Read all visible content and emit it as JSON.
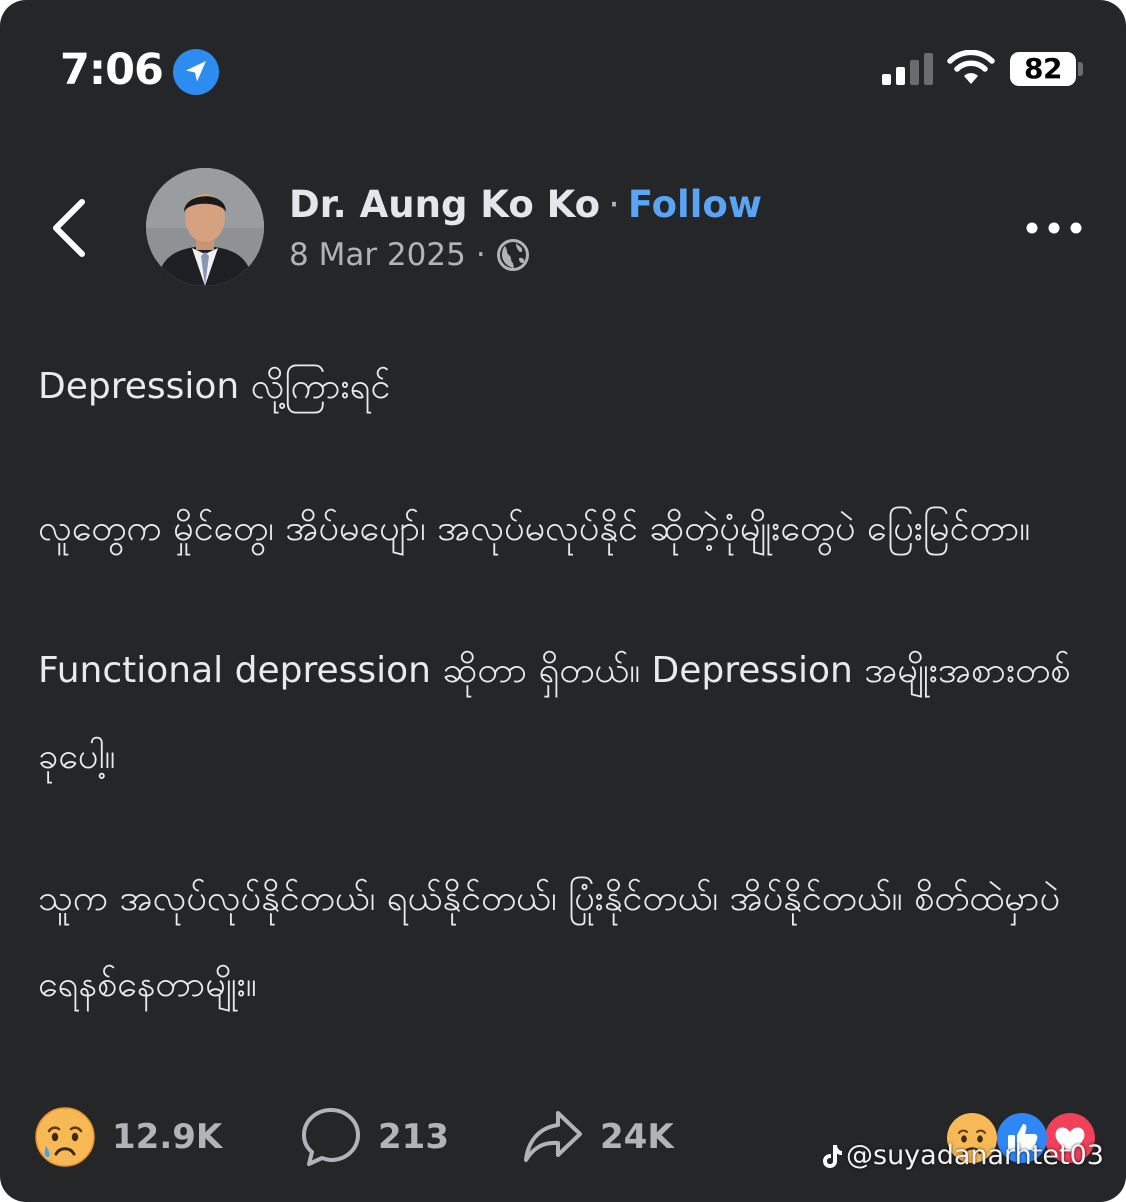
{
  "status_bar": {
    "time": "7:06",
    "battery": "82",
    "icons": [
      "location-arrow-icon",
      "cellular-signal-icon",
      "wifi-icon",
      "battery-icon"
    ]
  },
  "header": {
    "back_icon": "chevron-left-icon",
    "author_name": "Dr. Aung Ko Ko",
    "separator": "·",
    "follow_label": "Follow",
    "date": "8 Mar 2025",
    "meta_separator": "·",
    "audience_icon": "globe-icon",
    "more_icon": "more-horizontal-icon"
  },
  "post": {
    "paragraphs": [
      "Depression လို့ကြားရင်",
      "လူတွေက မှိုင်တွေ၊ အိပ်မပျော်၊ အလုပ်မလုပ်နိုင် ဆိုတဲ့ပုံမျိုးတွေပဲ ပြေးမြင်တာ။",
      "Functional depression ဆိုတာ ရှိတယ်။ Depression အမျိုးအစားတစ်ခုပေါ့။",
      "သူက အလုပ်လုပ်နိုင်တယ်၊ ရယ်နိုင်တယ်၊ ပြုံးနိုင်တယ်၊ အိပ်နိုင်တယ်။ စိတ်ထဲမှာပဲ ရေနစ်နေတာမျိုး။"
    ]
  },
  "footer": {
    "reactions_count": "12.9K",
    "comments_count": "213",
    "shares_count": "24K",
    "reaction_icons": [
      "sad-reaction-icon",
      "like-reaction-icon",
      "love-reaction-icon"
    ]
  },
  "watermark": {
    "text": "@suyadanarhtet03"
  },
  "colors": {
    "background": "#252628",
    "text_primary": "#e4e6eb",
    "text_secondary": "#b0b3b8",
    "link": "#5aa4f5"
  }
}
